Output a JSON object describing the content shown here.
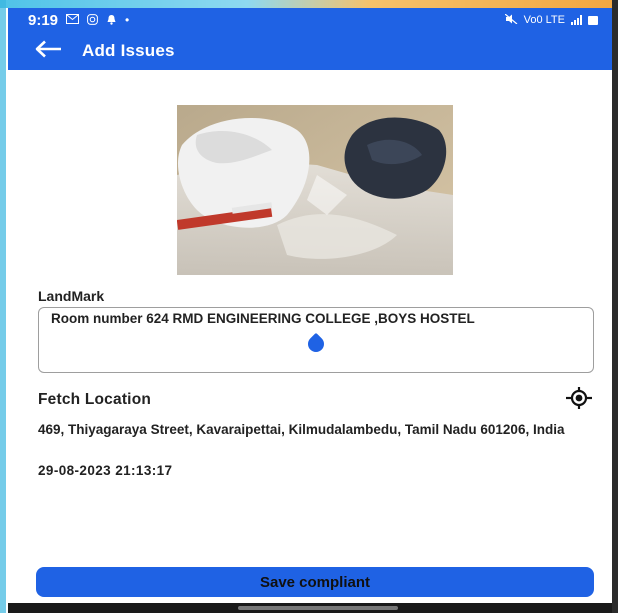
{
  "status_bar": {
    "time": "9:19",
    "icons": [
      "mail-icon",
      "instagram-icon",
      "notification-icon",
      "dot-icon"
    ],
    "right_icons": [
      "mute-icon",
      "volte-icon",
      "signal-icon",
      "battery-icon"
    ],
    "network_text": "Vo0 LTE"
  },
  "app_bar": {
    "title": "Add Issues",
    "back_icon": "arrow-left-icon",
    "color": "#1f62e4"
  },
  "photo": {
    "description_icon": "issue-photo"
  },
  "landmark": {
    "label": "LandMark",
    "value": "Room number 624 RMD ENGINEERING COLLEGE ,BOYS HOSTEL"
  },
  "location": {
    "label": "Fetch Location",
    "icon": "gps-target-icon",
    "address": "469, Thiyagaraya Street, Kavaraipettai, Kilmudalambedu, Tamil Nadu 601206, India"
  },
  "timestamp": "29-08-2023 21:13:17",
  "actions": {
    "save_label": "Save compliant"
  },
  "colors": {
    "primary": "#1f62e4",
    "text": "#222222"
  }
}
